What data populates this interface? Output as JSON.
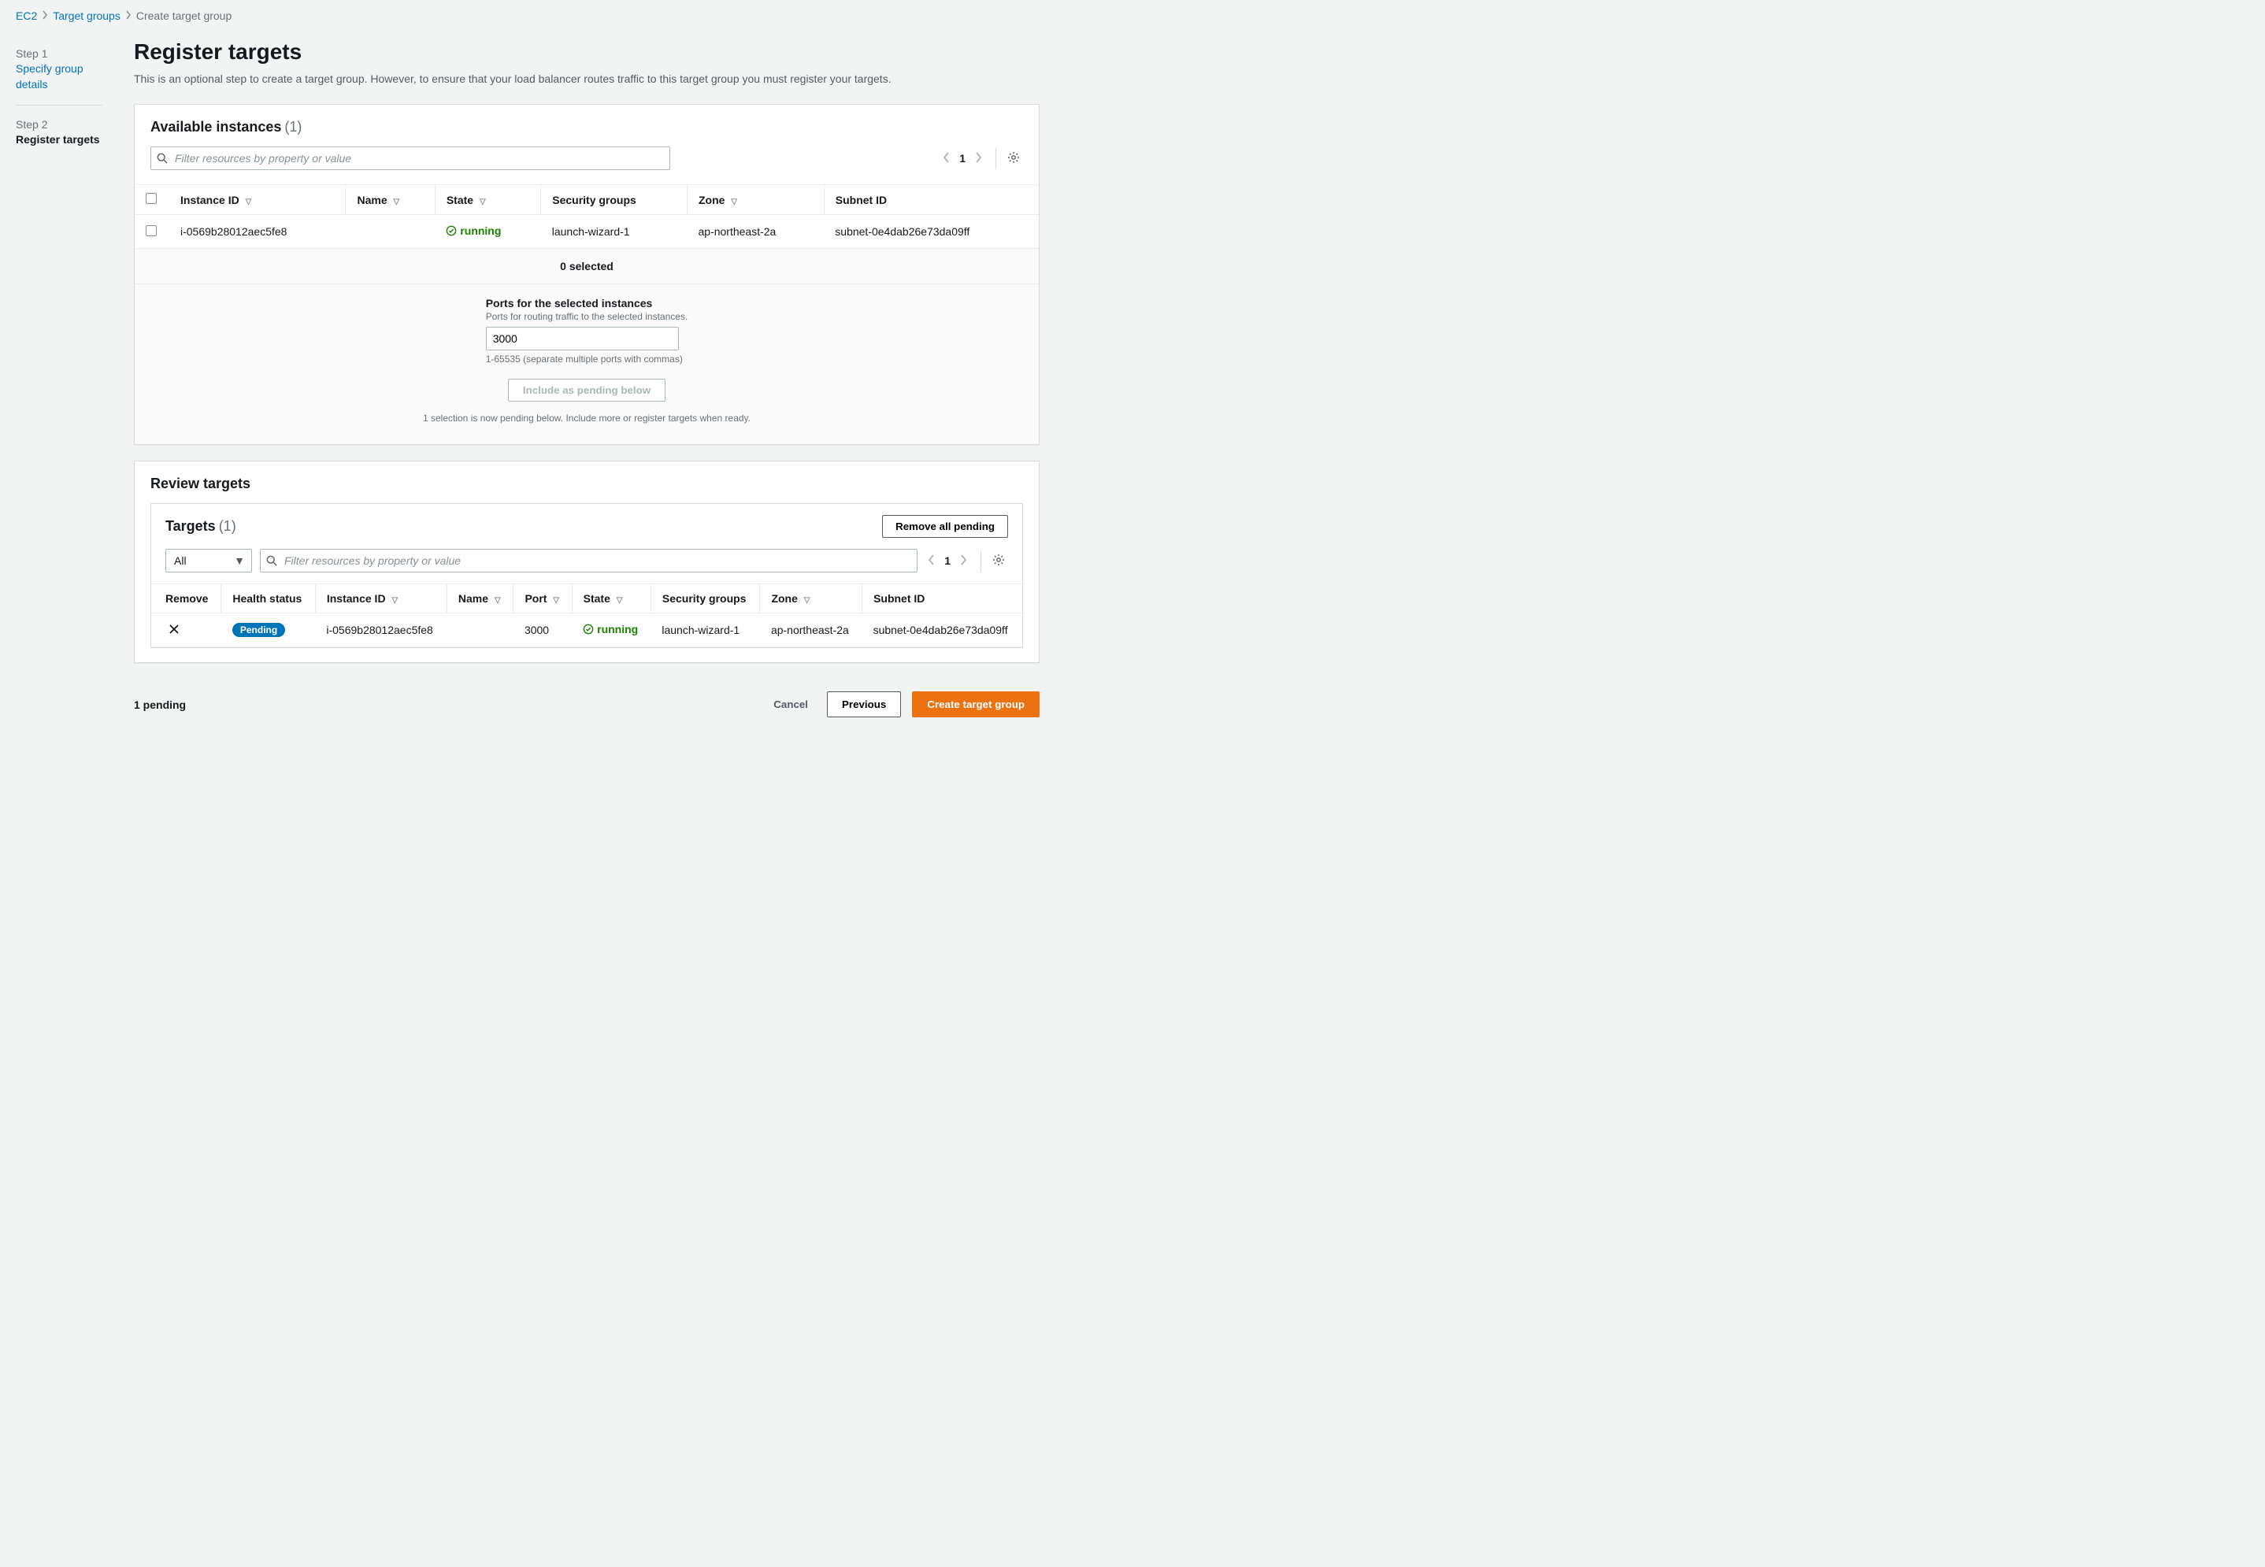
{
  "breadcrumb": {
    "ec2": "EC2",
    "target_groups": "Target groups",
    "current": "Create target group"
  },
  "sidebar": {
    "step1_label": "Step 1",
    "step1_link": "Specify group details",
    "step2_label": "Step 2",
    "step2_current": "Register targets"
  },
  "page": {
    "title": "Register targets",
    "subtitle": "This is an optional step to create a target group. However, to ensure that your load balancer routes traffic to this target group you must register your targets."
  },
  "available": {
    "title": "Available instances",
    "count": "(1)",
    "search_placeholder": "Filter resources by property or value",
    "page": "1",
    "columns": {
      "instance_id": "Instance ID",
      "name": "Name",
      "state": "State",
      "security_groups": "Security groups",
      "zone": "Zone",
      "subnet_id": "Subnet ID"
    },
    "rows": [
      {
        "instance_id": "i-0569b28012aec5fe8",
        "name": "",
        "state": "running",
        "security_groups": "launch-wizard-1",
        "zone": "ap-northeast-2a",
        "subnet_id": "subnet-0e4dab26e73da09ff"
      }
    ],
    "selected_text": "0 selected",
    "ports_label": "Ports for the selected instances",
    "ports_help": "Ports for routing traffic to the selected instances.",
    "ports_value": "3000",
    "ports_constraint": "1-65535 (separate multiple ports with commas)",
    "include_btn": "Include as pending below",
    "pending_note": "1 selection is now pending below. Include more or register targets when ready."
  },
  "review": {
    "title": "Review targets",
    "targets_title": "Targets",
    "targets_count": "(1)",
    "remove_all": "Remove all pending",
    "filter_all": "All",
    "search_placeholder": "Filter resources by property or value",
    "page": "1",
    "columns": {
      "remove": "Remove",
      "health": "Health status",
      "instance_id": "Instance ID",
      "name": "Name",
      "port": "Port",
      "state": "State",
      "security_groups": "Security groups",
      "zone": "Zone",
      "subnet_id": "Subnet ID"
    },
    "rows": [
      {
        "health": "Pending",
        "instance_id": "i-0569b28012aec5fe8",
        "name": "",
        "port": "3000",
        "state": "running",
        "security_groups": "launch-wizard-1",
        "zone": "ap-northeast-2a",
        "subnet_id": "subnet-0e4dab26e73da09ff"
      }
    ]
  },
  "footer": {
    "pending": "1 pending",
    "cancel": "Cancel",
    "previous": "Previous",
    "create": "Create target group"
  }
}
